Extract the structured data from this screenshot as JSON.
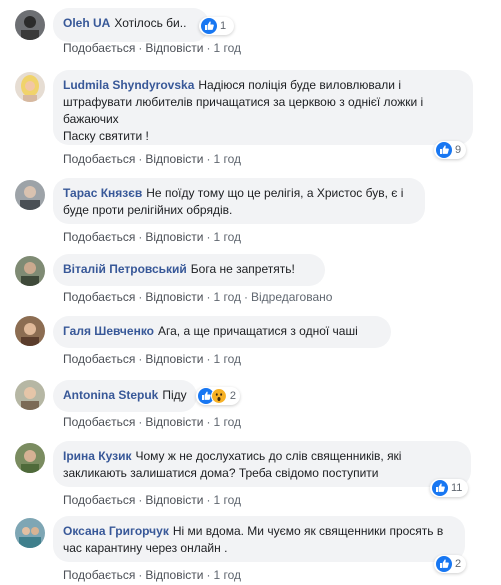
{
  "actions": {
    "like": "Подобається",
    "reply": "Відповісти"
  },
  "comments": [
    {
      "author": "Oleh UA",
      "text": "Хотілось би..",
      "count": "1",
      "time": "1 год",
      "edited": ""
    },
    {
      "author": "Ludmila Shyndyrovska",
      "text": "Надіюся поліція буде виловлювали і штрафувати любителів причащатися за церквою з однієї ложки і бажаючих\nПаску святити !",
      "count": "9",
      "time": "1 год",
      "edited": ""
    },
    {
      "author": "Тарас Князєв",
      "text": "Не поїду тому що це релігія, а Христос був, є і буде проти релігійних обрядів.",
      "count": "",
      "time": "1 год",
      "edited": ""
    },
    {
      "author": "Віталій Петровський",
      "text": "Бога не запретять!",
      "count": "",
      "time": "1 год",
      "edited": "Відредаговано"
    },
    {
      "author": "Галя Шевченко",
      "text": "Ага, а ще причащатися з одної чаші",
      "count": "",
      "time": "1 год",
      "edited": ""
    },
    {
      "author": "Antonina Stepuk",
      "text": "Піду",
      "count": "2",
      "time": "1 год",
      "edited": ""
    },
    {
      "author": "Ірина Кузик",
      "text": "Чому ж не дослухатись до слів священників, які закликають залишатися дома? Треба свідомо поступити",
      "count": "11",
      "time": "1 год",
      "edited": ""
    },
    {
      "author": "Оксана Григорчук",
      "text": "Ні ми вдома. Ми чуємо як священники просять в час карантину через онлайн .",
      "count": "2",
      "time": "1 год",
      "edited": ""
    }
  ],
  "colors": {
    "author": "#385898",
    "bubble": "#f2f3f5",
    "like": "#1877f2",
    "wow": "#f7b125"
  },
  "icons": {
    "like": "thumbs-up-icon",
    "wow": "wow-emoji-icon"
  }
}
